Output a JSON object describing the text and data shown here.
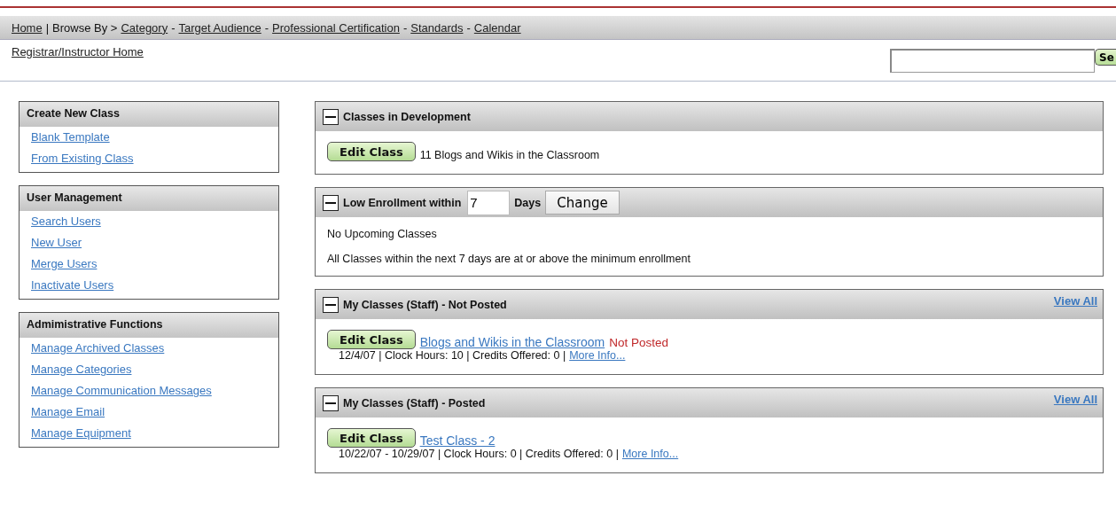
{
  "nav": {
    "home": "Home",
    "separator": "|",
    "browse_label": "Browse By >",
    "links": [
      "Category",
      "Target Audience",
      "Professional Certification",
      "Standards",
      "Calendar"
    ],
    "link_separator": "-"
  },
  "home_link": "Registrar/Instructor Home",
  "search": {
    "button": "Se"
  },
  "sidebar": [
    {
      "title": "Create New Class",
      "links": [
        "Blank Template",
        "From Existing Class"
      ]
    },
    {
      "title": "User Management",
      "links": [
        "Search Users",
        "New User",
        "Merge Users",
        "Inactivate Users"
      ]
    },
    {
      "title": "Admimistrative Functions",
      "links": [
        "Manage Archived Classes",
        "Manage Categories",
        "Manage Communication Messages",
        "Manage Email",
        "Manage Equipment"
      ]
    }
  ],
  "panels": [
    {
      "kind": "development",
      "title": "Classes in Development",
      "expanded": true,
      "items": [
        {
          "button": "Edit Class",
          "text": "11 Blogs and Wikis in the Classroom"
        }
      ]
    },
    {
      "kind": "enrollment",
      "title": "Low Enrollment within",
      "expanded": true,
      "days_value": "7",
      "days_label": "Days",
      "button": "Change",
      "lines": [
        "No Upcoming Classes",
        "All Classes within the next 7 days are at or above the minimum enrollment"
      ]
    },
    {
      "kind": "classes",
      "title": "My Classes (Staff) - Not Posted",
      "expanded": true,
      "view_all": "View All",
      "items": [
        {
          "button": "Edit Class",
          "name": "Blogs and Wikis in the Classroom",
          "status": "Not Posted",
          "details": "12/4/07 | Clock Hours: 10 | Credits Offered: 0 |",
          "more": "More Info..."
        }
      ]
    },
    {
      "kind": "classes",
      "title": "My Classes (Staff) - Posted",
      "expanded": true,
      "view_all": "View All",
      "items": [
        {
          "button": "Edit Class",
          "name": "Test Class - 2",
          "details": "10/22/07 - 10/29/07 | Clock Hours: 0 | Credits Offered: 0 |",
          "more": "More Info..."
        }
      ]
    }
  ]
}
